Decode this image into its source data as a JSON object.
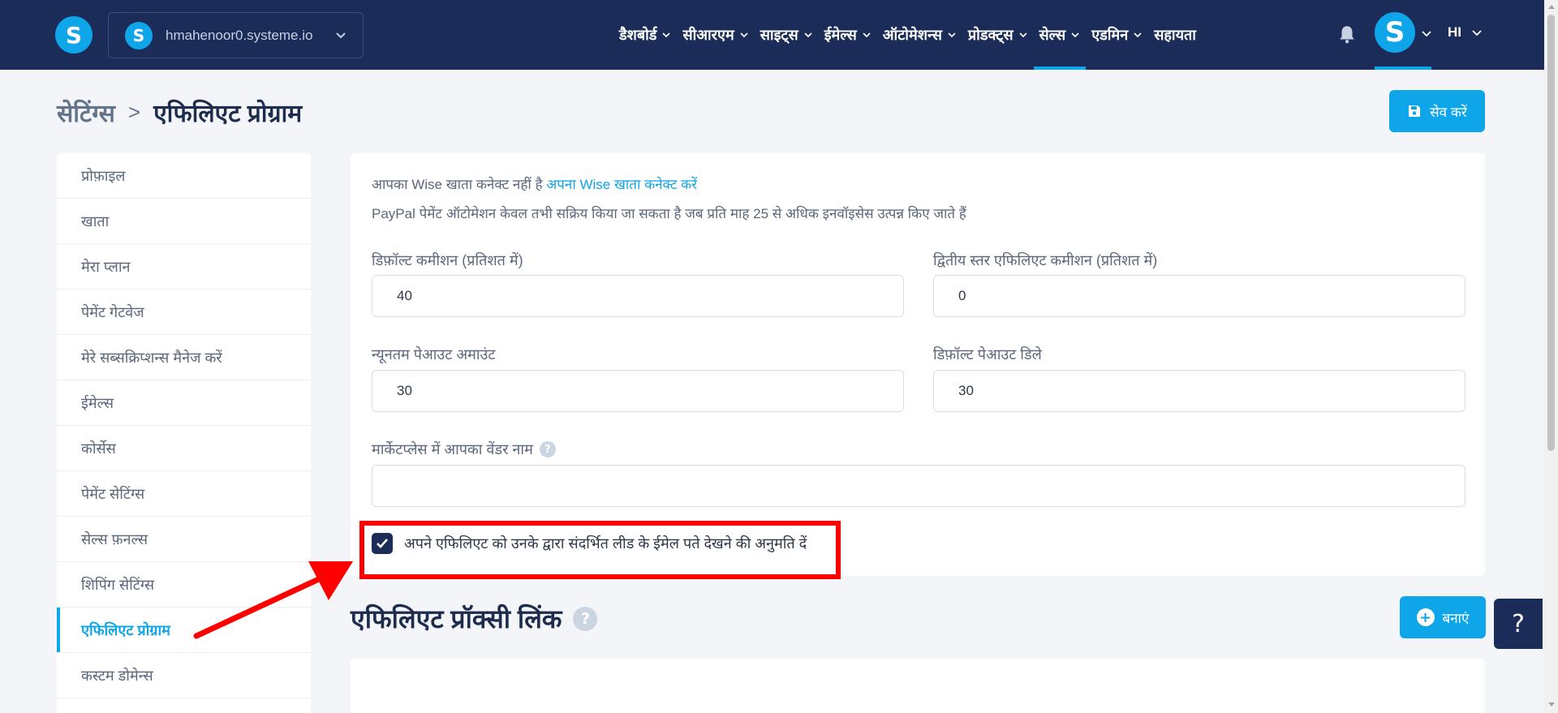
{
  "brand": {
    "logo_letter": "S",
    "accent": "#0ea5e9",
    "nav_bg": "#1a2c57"
  },
  "workspace": {
    "name": "hmahenoor0.systeme.io",
    "logo_letter": "S"
  },
  "nav": {
    "items": [
      {
        "label": "डैशबोर्ड",
        "active": false
      },
      {
        "label": "सीआरएम",
        "active": false
      },
      {
        "label": "साइट्स",
        "active": false
      },
      {
        "label": "ईमेल्स",
        "active": false
      },
      {
        "label": "ऑटोमेशन्स",
        "active": false
      },
      {
        "label": "प्रोडक्ट्स",
        "active": false
      },
      {
        "label": "सेल्स",
        "active": true
      },
      {
        "label": "एडमिन",
        "active": false
      }
    ],
    "help_label": "सहायता",
    "avatar_letter": "S",
    "language": "HI"
  },
  "breadcrumb": {
    "parent": "सेटिंग्स",
    "separator": ">",
    "current": "एफिलिएट प्रोग्राम"
  },
  "save_button": {
    "label": "सेव करें"
  },
  "sidebar": {
    "items": [
      {
        "label": "प्रोफ़ाइल",
        "active": false
      },
      {
        "label": "खाता",
        "active": false
      },
      {
        "label": "मेरा प्लान",
        "active": false
      },
      {
        "label": "पेमेंट गेटवेज",
        "active": false
      },
      {
        "label": "मेरे सब्सक्रिप्शन्स मैनेज करें",
        "active": false
      },
      {
        "label": "ईमेल्स",
        "active": false
      },
      {
        "label": "कोर्सेस",
        "active": false
      },
      {
        "label": "पेमेंट सेटिंग्स",
        "active": false
      },
      {
        "label": "सेल्स फ़नल्स",
        "active": false
      },
      {
        "label": "शिपिंग सेटिंग्स",
        "active": false
      },
      {
        "label": "एफिलिएट प्रोग्राम",
        "active": true
      },
      {
        "label": "कस्टम डोमेन्स",
        "active": false
      }
    ]
  },
  "settings": {
    "wise_notice": "आपका Wise खाता कनेक्ट नहीं है",
    "wise_link": "अपना Wise खाता कनेक्ट करें",
    "paypal_notice": "PayPal पेमेंट ऑटोमेशन केवल तभी सक्रिय किया जा सकता है जब प्रति माह 25 से अधिक इनवॉइसेस उत्पन्न किए जाते हैं",
    "fields": {
      "default_commission": {
        "label": "डिफ़ॉल्ट कमीशन (प्रतिशत में)",
        "value": "40"
      },
      "second_tier_commission": {
        "label": "द्वितीय स्तर एफिलिएट कमीशन (प्रतिशत में)",
        "value": "0"
      },
      "min_payout": {
        "label": "न्यूनतम पेआउट अमाउंट",
        "value": "30"
      },
      "payout_delay": {
        "label": "डिफ़ॉल्ट पेआउट डिले",
        "value": "30"
      },
      "vendor_name": {
        "label": "मार्केटप्लेस में आपका वेंडर नाम",
        "value": ""
      }
    },
    "allow_emails": {
      "label": "अपने एफिलिएट को उनके द्वारा संदर्भित लीड के ईमेल पते देखने की अनुमति दें",
      "checked": true
    }
  },
  "proxy": {
    "title": "एफिलिएट प्रॉक्सी लिंक",
    "create_label": "बनाएं"
  },
  "floating_help": {
    "label": "?"
  },
  "annotation": {
    "color": "#ff0000"
  }
}
